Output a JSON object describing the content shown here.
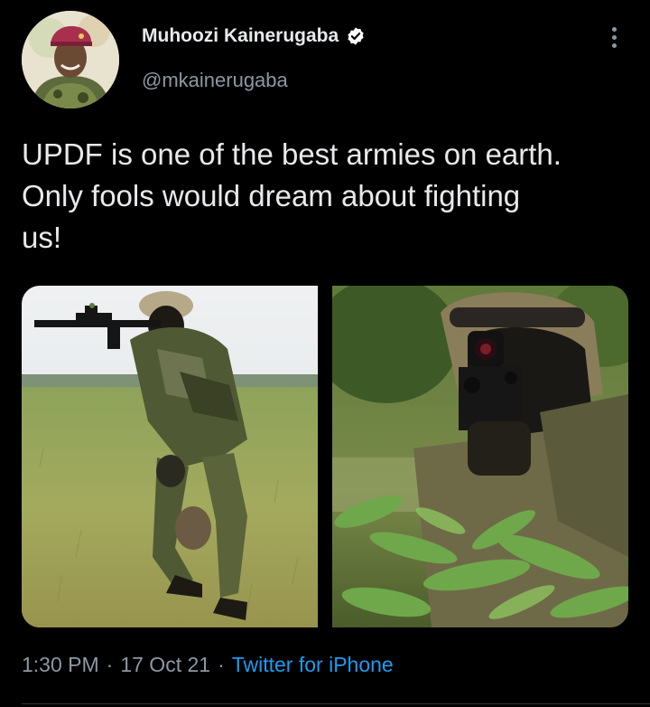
{
  "tweet": {
    "author": {
      "display_name": "Muhoozi Kainerugaba",
      "handle": "@mkainerugaba",
      "verified": true,
      "avatar_icon": "avatar-portrait"
    },
    "text": "UPDF is one of the best armies on earth.\nOnly fools would dream about fighting\nus!",
    "media": [
      {
        "icon": "photo-soldier-aiming-rifle-grass-field"
      },
      {
        "icon": "photo-soldier-rifle-optic-foliage"
      }
    ],
    "meta": {
      "time": "1:30 PM",
      "date": "17 Oct 21",
      "separator": "·",
      "source": "Twitter for iPhone"
    }
  },
  "colors": {
    "background": "#000000",
    "text_primary": "#e7e9ea",
    "text_secondary": "#8b98a5",
    "link": "#1d9bf0",
    "verified_badge": "#ffffff"
  }
}
